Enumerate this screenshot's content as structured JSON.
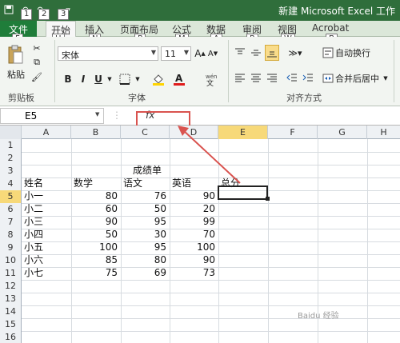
{
  "window": {
    "title": "新建 Microsoft Excel 工作"
  },
  "quick_access": {
    "keytips": [
      "1",
      "2",
      "3"
    ]
  },
  "tabs": [
    {
      "label": "文件",
      "keytip": "F"
    },
    {
      "label": "开始",
      "keytip": "H"
    },
    {
      "label": "插入",
      "keytip": "N"
    },
    {
      "label": "页面布局",
      "keytip": "P"
    },
    {
      "label": "公式",
      "keytip": "M"
    },
    {
      "label": "数据",
      "keytip": "A"
    },
    {
      "label": "审阅",
      "keytip": "R"
    },
    {
      "label": "视图",
      "keytip": "W"
    },
    {
      "label": "Acrobat",
      "keytip": "B"
    }
  ],
  "ribbon": {
    "clipboard": {
      "paste_label": "粘贴",
      "group_label": "剪贴板"
    },
    "font": {
      "name": "宋体",
      "size": "11",
      "bold": "B",
      "italic": "I",
      "underline": "U",
      "group_label": "字体"
    },
    "alignment": {
      "wrap_label": "自动换行",
      "merge_label": "合并后居中",
      "group_label": "对齐方式"
    }
  },
  "formula_bar": {
    "cell_ref": "E5",
    "fx_label": "fx"
  },
  "columns": [
    "A",
    "B",
    "C",
    "D",
    "E",
    "F",
    "G",
    "H"
  ],
  "rows": [
    "1",
    "2",
    "3",
    "4",
    "5",
    "6",
    "7",
    "8",
    "9",
    "10",
    "11",
    "12",
    "13",
    "14",
    "15",
    "16"
  ],
  "sheet": {
    "title": "成绩单",
    "headers": [
      "姓名",
      "数学",
      "语文",
      "英语",
      "总分"
    ],
    "records": [
      {
        "name": "小一",
        "math": "80",
        "chinese": "76",
        "english": "90"
      },
      {
        "name": "小二",
        "math": "60",
        "chinese": "50",
        "english": "20"
      },
      {
        "name": "小三",
        "math": "90",
        "chinese": "95",
        "english": "99"
      },
      {
        "name": "小四",
        "math": "50",
        "chinese": "30",
        "english": "70"
      },
      {
        "name": "小五",
        "math": "100",
        "chinese": "95",
        "english": "100"
      },
      {
        "name": "小六",
        "math": "85",
        "chinese": "80",
        "english": "90"
      },
      {
        "name": "小七",
        "math": "75",
        "chinese": "69",
        "english": "73"
      }
    ]
  },
  "colors": {
    "excel_green": "#2f6e3b",
    "annotation_red": "#d9534f"
  }
}
